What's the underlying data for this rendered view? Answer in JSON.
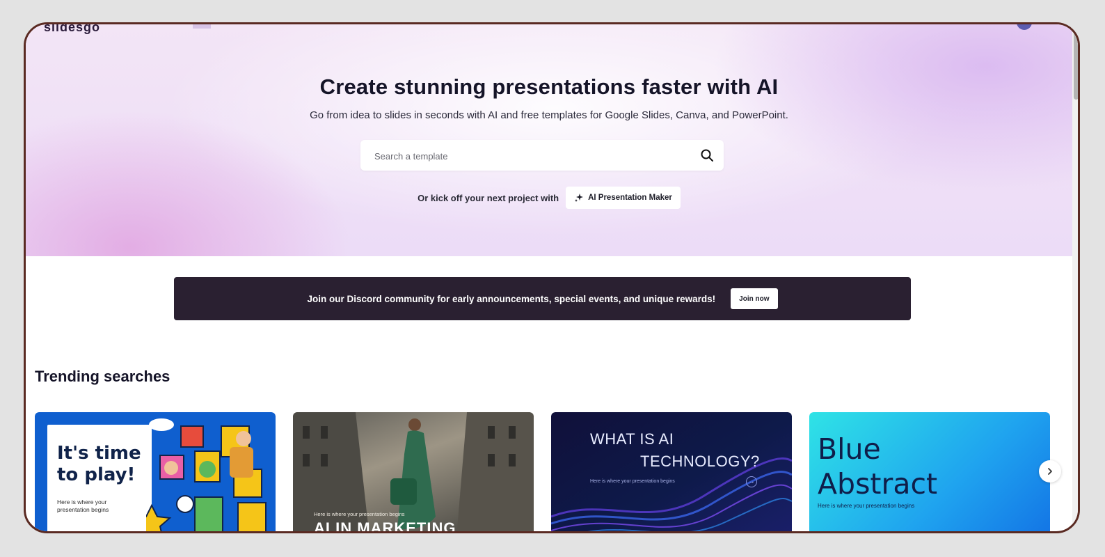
{
  "header": {
    "logo_text": "slidesgo"
  },
  "hero": {
    "title": "Create stunning presentations faster with AI",
    "subtitle": "Go from idea to slides in seconds with AI and free templates for Google Slides, Canva, and PowerPoint.",
    "search_placeholder": "Search a template",
    "kickoff_label": "Or kick off your next project with",
    "ai_button_label": "AI Presentation Maker"
  },
  "discord_banner": {
    "text": "Join our Discord community for early announcements, special events, and unique rewards!",
    "button_label": "Join now",
    "background": "#2a2031"
  },
  "trending": {
    "title": "Trending searches",
    "cards": [
      {
        "title_line1": "It's time",
        "title_line2": "to play!",
        "subtitle": "Here is where your presentation begins"
      },
      {
        "subtitle": "Here is where your presentation begins",
        "title": "AI IN MARKETING"
      },
      {
        "title_line1": "WHAT IS AI",
        "title_line2": "TECHNOLOGY?",
        "subtitle": "Here is where your presentation begins"
      },
      {
        "title_line1": "Blue",
        "title_line2": "Abstract",
        "subtitle": "Here is where your presentation begins"
      }
    ]
  },
  "icons": {
    "search": "search-icon",
    "sparkle": "sparkle-icon",
    "next": "chevron-right-icon"
  }
}
